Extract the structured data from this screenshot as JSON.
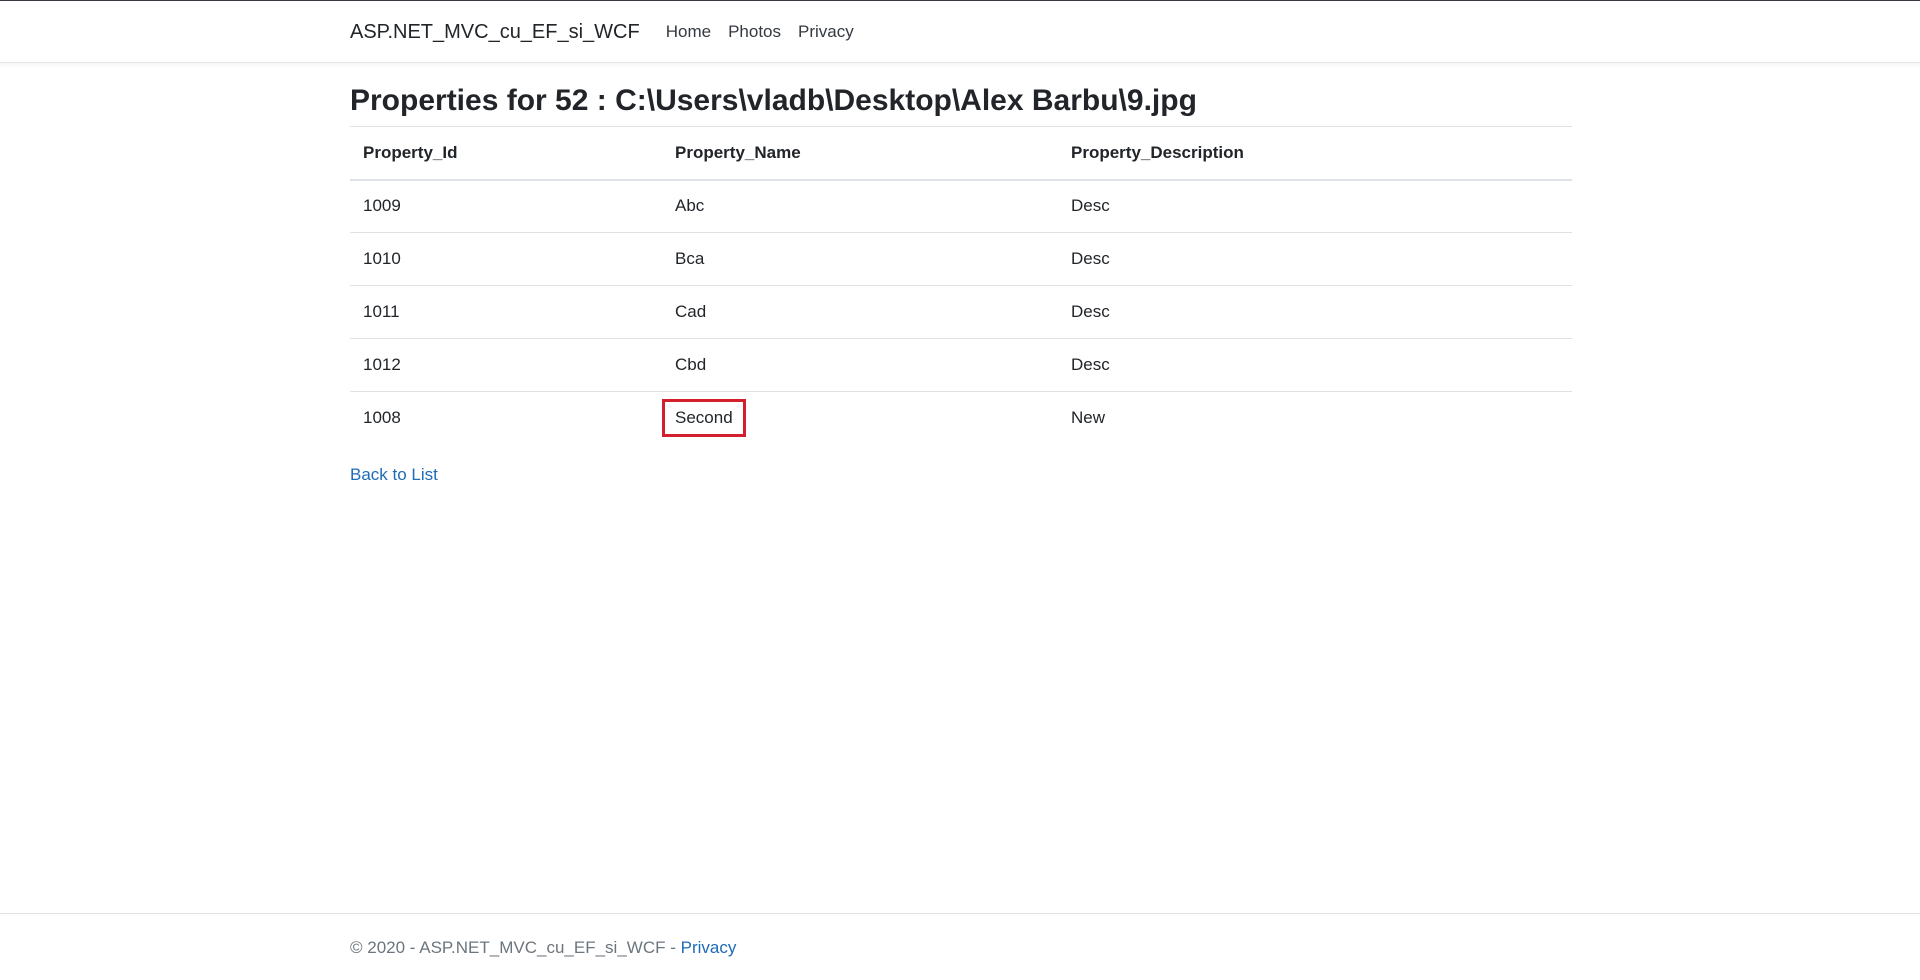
{
  "navbar": {
    "brand": "ASP.NET_MVC_cu_EF_si_WCF",
    "links": [
      "Home",
      "Photos",
      "Privacy"
    ]
  },
  "main": {
    "title": "Properties for 52 : C:\\Users\\vladb\\Desktop\\Alex Barbu\\9.jpg",
    "table": {
      "headers": [
        "Property_Id",
        "Property_Name",
        "Property_Description"
      ],
      "rows": [
        [
          "1009",
          "Abc",
          "Desc"
        ],
        [
          "1010",
          "Bca",
          "Desc"
        ],
        [
          "1011",
          "Cad",
          "Desc"
        ],
        [
          "1012",
          "Cbd",
          "Desc"
        ],
        [
          "1008",
          "Second",
          "New"
        ]
      ]
    },
    "back_link": "Back to List"
  },
  "footer": {
    "text": "© 2020 - ASP.NET_MVC_cu_EF_si_WCF - ",
    "privacy_link": "Privacy"
  },
  "colors": {
    "link": "#1e6bb8",
    "highlight_box": "#d3202f",
    "text": "#212529"
  }
}
